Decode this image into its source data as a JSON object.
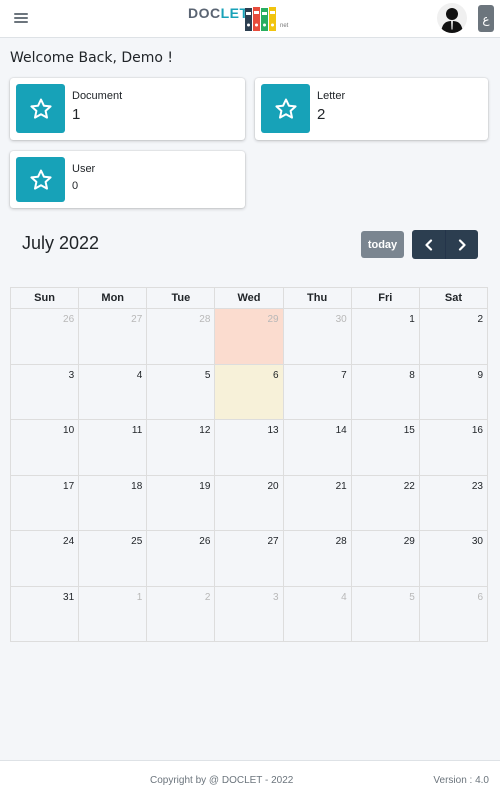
{
  "header": {
    "logo_text_primary": "DOC",
    "logo_text_accent": "LET",
    "logo_sub": "net",
    "lang_label": "ع",
    "brand_color": "#17a2b8"
  },
  "welcome": "Welcome Back, Demo !",
  "stats": [
    {
      "label": "Document",
      "value": "1",
      "icon": "star-icon"
    },
    {
      "label": "Letter",
      "value": "2",
      "icon": "star-icon"
    },
    {
      "label": "User",
      "value": "0",
      "icon": "star-icon"
    }
  ],
  "calendar": {
    "title": "July 2022",
    "today_label": "today",
    "weekdays": [
      "Sun",
      "Mon",
      "Tue",
      "Wed",
      "Thu",
      "Fri",
      "Sat"
    ],
    "weeks": [
      [
        {
          "d": "26",
          "other": true
        },
        {
          "d": "27",
          "other": true
        },
        {
          "d": "28",
          "other": true
        },
        {
          "d": "29",
          "other": true,
          "highlight": true
        },
        {
          "d": "30",
          "other": true
        },
        {
          "d": "1"
        },
        {
          "d": "2"
        }
      ],
      [
        {
          "d": "3"
        },
        {
          "d": "4"
        },
        {
          "d": "5"
        },
        {
          "d": "6",
          "today": true
        },
        {
          "d": "7"
        },
        {
          "d": "8"
        },
        {
          "d": "9"
        }
      ],
      [
        {
          "d": "10"
        },
        {
          "d": "11"
        },
        {
          "d": "12"
        },
        {
          "d": "13"
        },
        {
          "d": "14"
        },
        {
          "d": "15"
        },
        {
          "d": "16"
        }
      ],
      [
        {
          "d": "17"
        },
        {
          "d": "18"
        },
        {
          "d": "19"
        },
        {
          "d": "20"
        },
        {
          "d": "21"
        },
        {
          "d": "22"
        },
        {
          "d": "23"
        }
      ],
      [
        {
          "d": "24"
        },
        {
          "d": "25"
        },
        {
          "d": "26"
        },
        {
          "d": "27"
        },
        {
          "d": "28"
        },
        {
          "d": "29"
        },
        {
          "d": "30"
        }
      ],
      [
        {
          "d": "31"
        },
        {
          "d": "1",
          "other": true
        },
        {
          "d": "2",
          "other": true
        },
        {
          "d": "3",
          "other": true
        },
        {
          "d": "4",
          "other": true
        },
        {
          "d": "5",
          "other": true
        },
        {
          "d": "6",
          "other": true
        }
      ]
    ]
  },
  "footer": {
    "copyright": "Copyright by @ DOCLET - 2022",
    "version": "Version : 4.0"
  }
}
